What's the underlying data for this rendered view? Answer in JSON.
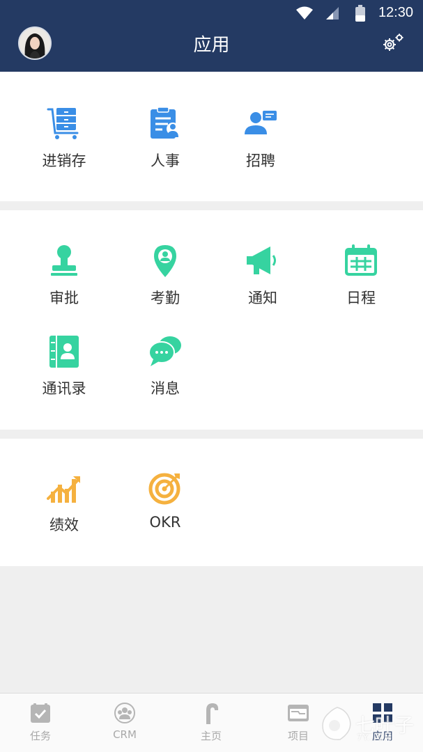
{
  "status_bar": {
    "time": "12:30"
  },
  "header": {
    "title": "应用"
  },
  "sections": [
    {
      "items": [
        {
          "label": "进销存"
        },
        {
          "label": "人事"
        },
        {
          "label": "招聘"
        }
      ]
    },
    {
      "items": [
        {
          "label": "审批"
        },
        {
          "label": "考勤"
        },
        {
          "label": "通知"
        },
        {
          "label": "日程"
        },
        {
          "label": "通讯录"
        },
        {
          "label": "消息"
        }
      ]
    },
    {
      "items": [
        {
          "label": "绩效"
        },
        {
          "label": "OKR"
        }
      ]
    }
  ],
  "colors": {
    "header_bg": "#243a63",
    "blue_icons": "#3a8ee6",
    "green_icons": "#36d3a0",
    "orange_icons": "#f5b13f",
    "inactive_nav": "#a9a9a9"
  },
  "bottom_nav": [
    {
      "label": "任务",
      "icon": "task-check-icon",
      "active": false
    },
    {
      "label": "CRM",
      "icon": "crm-users-icon",
      "active": false
    },
    {
      "label": "主页",
      "icon": "home-hook-icon",
      "active": false
    },
    {
      "label": "项目",
      "icon": "project-folder-icon",
      "active": false
    },
    {
      "label": "应用",
      "icon": "apps-grid-icon",
      "active": true
    }
  ],
  "watermark": {
    "text": "七叶子",
    "url": "7Y...OM"
  }
}
